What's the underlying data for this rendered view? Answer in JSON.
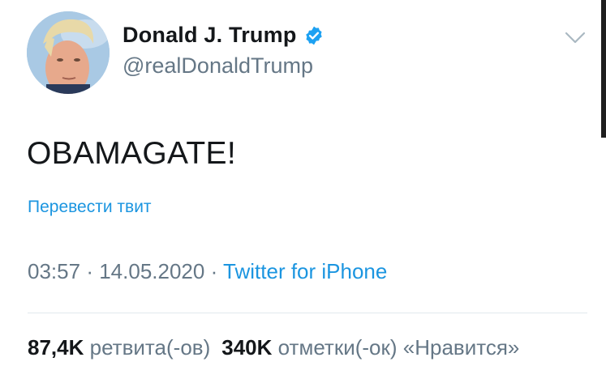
{
  "user": {
    "display_name": "Donald J. Trump",
    "handle": "@realDonaldTrump",
    "verified": true,
    "verified_color": "#1da1f2"
  },
  "tweet": {
    "text": "OBAMAGATE!",
    "translate_label": "Перевести твит",
    "time": "03:57",
    "separator": "·",
    "date": "14.05.2020",
    "source": "Twitter for iPhone"
  },
  "stats": {
    "retweets_count": "87,4K",
    "retweets_label": "ретвита(-ов)",
    "likes_count": "340K",
    "likes_label": "отметки(-ок) «Нравится»"
  },
  "icons": {
    "verified": "verified-badge-icon",
    "caret": "chevron-down-icon"
  },
  "colors": {
    "link": "#1b95e0",
    "secondary_text": "#657786",
    "primary_text": "#14171a"
  }
}
